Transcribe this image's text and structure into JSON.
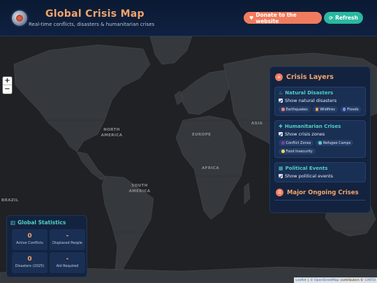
{
  "header": {
    "title": "Global Crisis Map",
    "subtitle": "Real-time conflicts, disasters & humanitarian crises",
    "donate_label": "Donate to the website",
    "refresh_label": "Refresh"
  },
  "map": {
    "labels": {
      "north_america": "NORTH AMERICA",
      "south_america": "SOUTH AMERICA",
      "europe": "EUROPE",
      "africa": "AFRICA",
      "asia": "ASIA",
      "brazil": "BRAZIL"
    },
    "zoom_in": "+",
    "zoom_out": "−"
  },
  "layers": {
    "title": "Crisis Layers",
    "natural": {
      "title": "Natural Disasters",
      "toggle_label": "Show natural disasters",
      "tags": [
        {
          "label": "Earthquakes",
          "color": "#f07c7c"
        },
        {
          "label": "Wildfires",
          "color": "#f6a04d"
        },
        {
          "label": "Floods",
          "color": "#6f8ff0"
        }
      ]
    },
    "humanitarian": {
      "title": "Humanitarian Crises",
      "toggle_label": "Show crisis zones",
      "tags": [
        {
          "label": "Conflict Zones",
          "color": "#7a3aa8"
        },
        {
          "label": "Refugee Camps",
          "color": "#4fd1c5"
        },
        {
          "label": "Food Insecurity",
          "color": "#f2d25c"
        }
      ]
    },
    "political": {
      "title": "Political Events",
      "toggle_label": "Show political events"
    },
    "major_title": "Major Ongoing Crises"
  },
  "stats": {
    "title": "Global Statistics",
    "cells": [
      {
        "value": "0",
        "label": "Active Conflicts"
      },
      {
        "value": "-",
        "label": "Displaced People"
      },
      {
        "value": "0",
        "label": "Disasters (2025)"
      },
      {
        "value": "-",
        "label": "Aid Required"
      }
    ]
  },
  "attribution": {
    "leaflet": "Leaflet",
    "sep": "|",
    "osm": "© OpenStreetMap",
    "contrib": "contributors ©",
    "carto": "CARTO"
  },
  "colors": {
    "accent_orange": "#f3a46a",
    "accent_teal": "#4fd1c5",
    "donate": "#f07c5d",
    "refresh": "#2ab8a0",
    "panel": "#13233f"
  }
}
